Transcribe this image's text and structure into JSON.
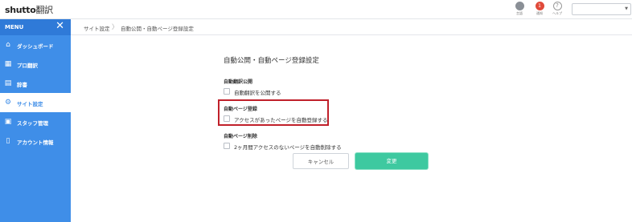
{
  "header": {
    "logo_main": "shutto",
    "logo_sub": "翻訳",
    "icons": [
      {
        "name": "globe-icon",
        "label": "言語"
      },
      {
        "name": "notification-icon",
        "label": "通知",
        "badge": "1"
      },
      {
        "name": "help-icon",
        "label": "ヘルプ",
        "glyph": "?"
      }
    ],
    "select_value": ""
  },
  "sidebar": {
    "title": "MENU",
    "close_glyph": "✕",
    "items": [
      {
        "label": "ダッシュボード",
        "icon": "home-icon",
        "glyph": "⌂"
      },
      {
        "label": "プロ翻訳",
        "icon": "grid-icon",
        "glyph": "▦"
      },
      {
        "label": "辞書",
        "icon": "book-icon",
        "glyph": "▤"
      },
      {
        "label": "サイト設定",
        "icon": "gear-icon",
        "glyph": "⚙",
        "active": true
      },
      {
        "label": "スタッフ管理",
        "icon": "staff-icon",
        "glyph": "▣"
      },
      {
        "label": "アカウント情報",
        "icon": "document-icon",
        "glyph": "▯"
      }
    ]
  },
  "breadcrumb": {
    "parent": "サイト設定",
    "separator": "〉",
    "current": "自動公開・自動ページ登録設定"
  },
  "main": {
    "title": "自動公開・自動ページ登録設定",
    "sections": [
      {
        "label": "自動翻訳公開",
        "checkbox_label": "自動翻訳を公開する"
      },
      {
        "label": "自動ページ登録",
        "checkbox_label": "アクセスがあったページを自動登録する"
      },
      {
        "label": "自動ページ削除",
        "checkbox_label": "2ヶ月間アクセスのないページを自動削除する"
      }
    ],
    "cancel_label": "キャンセル",
    "submit_label": "変更"
  },
  "colors": {
    "sidebar": "#3f8ee8",
    "accent_button": "#3ec9a0",
    "highlight_border": "#c0202a"
  }
}
